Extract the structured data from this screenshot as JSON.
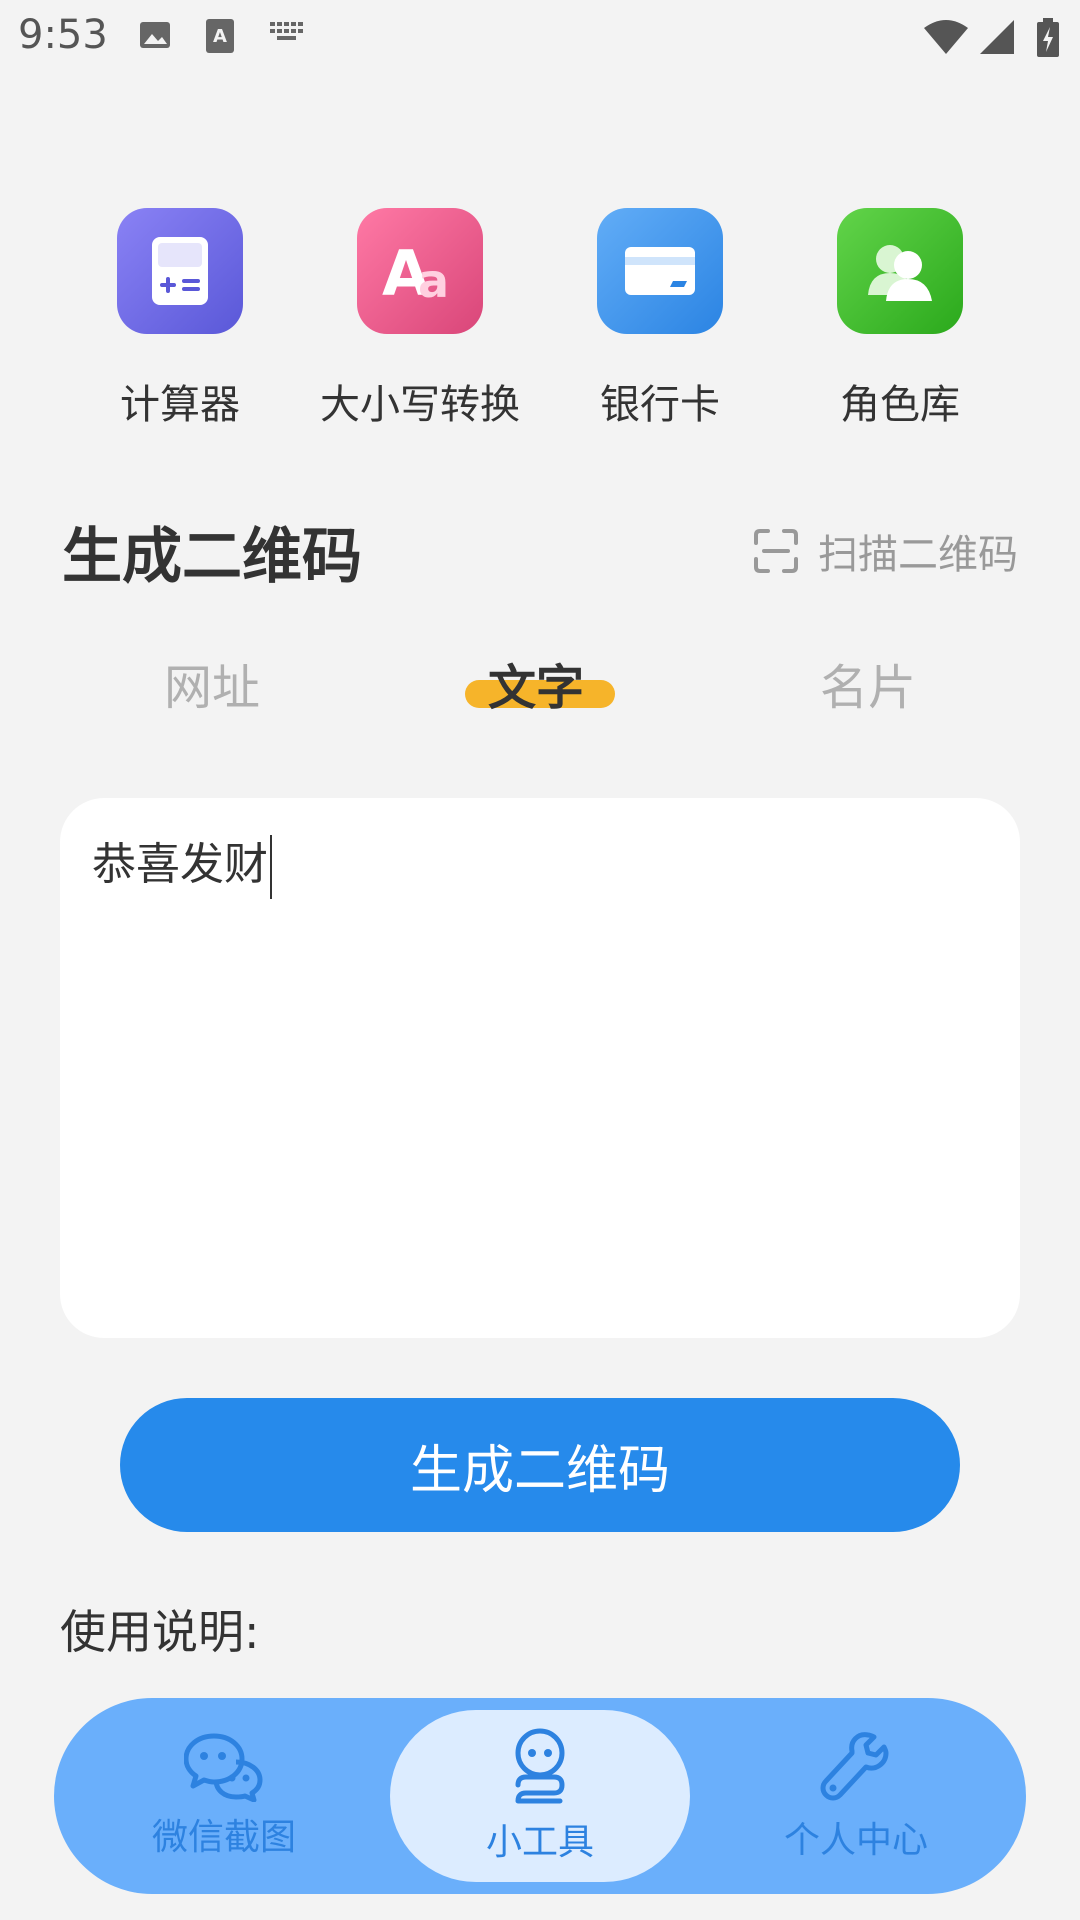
{
  "status_bar": {
    "time": "9:53",
    "left_icons": [
      "image-icon",
      "text-input-icon",
      "keyboard-icon"
    ],
    "right_icons": [
      "wifi-icon",
      "signal-icon",
      "battery-charging-icon"
    ]
  },
  "tools": [
    {
      "label": "计算器",
      "icon": "calculator-icon",
      "color": "#6f6ae8"
    },
    {
      "label": "大小写转换",
      "icon": "case-convert-icon",
      "color": "#ec5a8c"
    },
    {
      "label": "银行卡",
      "icon": "bank-card-icon",
      "color": "#3c92ea"
    },
    {
      "label": "角色库",
      "icon": "characters-icon",
      "color": "#3fbe2a"
    }
  ],
  "qr": {
    "title": "生成二维码",
    "scan_label": "扫描二维码"
  },
  "mode_tabs": [
    {
      "label": "网址",
      "active": false
    },
    {
      "label": "文字",
      "active": true
    },
    {
      "label": "名片",
      "active": false
    }
  ],
  "input": {
    "value": "恭喜发财"
  },
  "generate_button": "生成二维码",
  "instructions_title": "使用说明:",
  "bottom_nav": [
    {
      "label": "微信截图",
      "icon": "wechat-chat-icon",
      "active": false
    },
    {
      "label": "小工具",
      "icon": "robot-tools-icon",
      "active": true
    },
    {
      "label": "个人中心",
      "icon": "wrench-icon",
      "active": false
    }
  ],
  "colors": {
    "primary": "#268aeb",
    "accent": "#f6b42a",
    "nav_bg": "#6aaffb",
    "nav_active_bg": "#dcecff",
    "background": "#f3f3f3"
  }
}
